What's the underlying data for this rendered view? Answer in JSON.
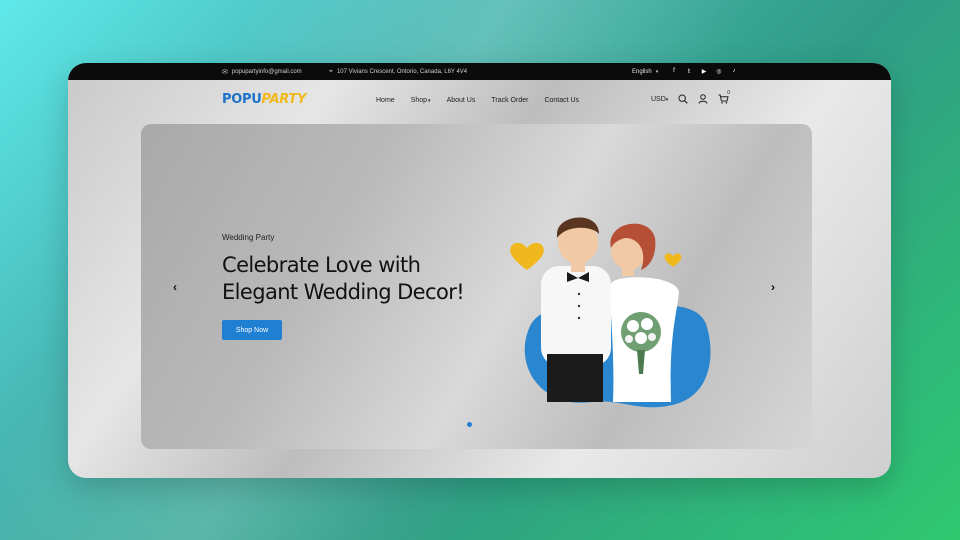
{
  "topbar": {
    "email": "popupartyinfo@gmail.com",
    "address": "107 Vivians Crescent, Ontorio, Canada, L6Y 4V4",
    "language": "English",
    "social": [
      "facebook-icon",
      "twitter-icon",
      "youtube-icon",
      "instagram-icon",
      "tiktok-icon"
    ]
  },
  "header": {
    "logo_part1": "POPU",
    "logo_part2": "PARTY",
    "nav": {
      "home": "Home",
      "shop": "Shop",
      "about": "About Us",
      "track": "Track Order",
      "contact": "Contact Us"
    },
    "currency": "USD",
    "cart_count": "0"
  },
  "hero": {
    "subtitle": "Wedding Party",
    "title_line1": "Celebrate Love with",
    "title_line2": "Elegant Wedding Decor!",
    "cta": "Shop Now",
    "slides_total": 2,
    "active_slide": 1
  },
  "colors": {
    "accent": "#1f7fd2",
    "logo_blue": "#1e73c8",
    "logo_yellow": "#f1b81d",
    "topbar_bg": "#0b0b0b"
  }
}
